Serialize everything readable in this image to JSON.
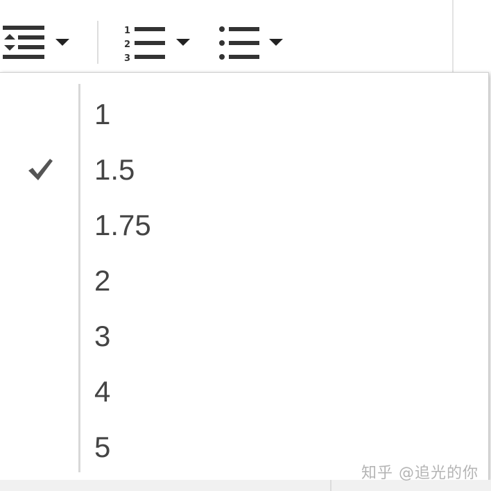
{
  "toolbar": {
    "buttons": [
      {
        "icon": "line-spacing-icon",
        "has_dropdown": true
      },
      {
        "icon": "numbered-list-icon",
        "has_dropdown": true,
        "numbers": [
          "1",
          "2",
          "3"
        ]
      },
      {
        "icon": "bulleted-list-icon",
        "has_dropdown": true
      }
    ]
  },
  "menu": {
    "items": [
      {
        "label": "1",
        "checked": false
      },
      {
        "label": "1.5",
        "checked": true
      },
      {
        "label": "1.75",
        "checked": false
      },
      {
        "label": "2",
        "checked": false
      },
      {
        "label": "3",
        "checked": false
      },
      {
        "label": "4",
        "checked": false
      },
      {
        "label": "5",
        "checked": false
      }
    ],
    "check_icon": "checkmark-icon"
  },
  "watermark": {
    "text": "知乎 @追光的你"
  },
  "colors": {
    "text": "#444444",
    "icon": "#333333",
    "check": "#555555",
    "watermark": "#b4b4b4"
  }
}
